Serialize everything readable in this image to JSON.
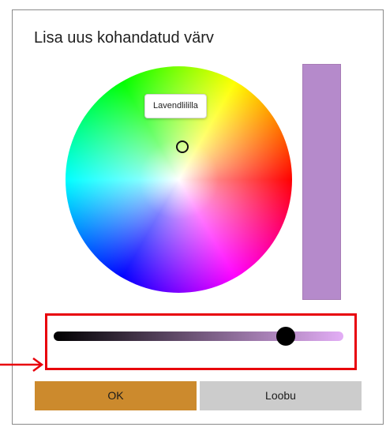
{
  "dialog": {
    "title": "Lisa uus kohandatud värv",
    "tooltip_label": "Lavendlililla",
    "preview_color": "#b58acb",
    "slider": {
      "value": 0.8,
      "gradient_start": "#000000",
      "gradient_end": "#e3aef6"
    },
    "ok_label": "OK",
    "cancel_label": "Loobu",
    "ok_color": "#cc8a2d",
    "highlight_color": "#e8000b"
  }
}
